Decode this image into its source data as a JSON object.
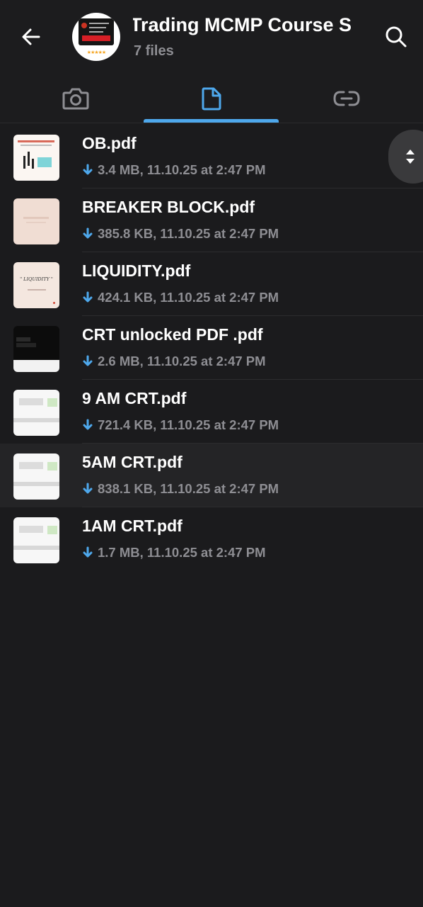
{
  "header": {
    "title": "Trading MCMP Course   S",
    "subtitle": "7 files",
    "avatar_stars": "★★★★★"
  },
  "tabs": [
    {
      "name": "media",
      "icon": "camera-icon",
      "active": false
    },
    {
      "name": "files",
      "icon": "file-icon",
      "active": true
    },
    {
      "name": "links",
      "icon": "link-icon",
      "active": false
    }
  ],
  "files": [
    {
      "name": "OB.pdf",
      "meta": "3.4 MB, 11.10.25 at 2:47 PM",
      "thumb": "ob"
    },
    {
      "name": "BREAKER BLOCK.pdf",
      "meta": "385.8 KB, 11.10.25 at 2:47 PM",
      "thumb": "breaker"
    },
    {
      "name": "LIQUIDITY.pdf",
      "meta": "424.1 KB, 11.10.25 at 2:47 PM",
      "thumb": "liquidity",
      "thumb_text": "\" LIQUIDITY \""
    },
    {
      "name": "CRT unlocked PDF .pdf",
      "meta": "2.6 MB, 11.10.25 at 2:47 PM",
      "thumb": "crt"
    },
    {
      "name": "9 AM CRT.pdf",
      "meta": "721.4 KB, 11.10.25 at 2:47 PM",
      "thumb": "doc"
    },
    {
      "name": "5AM CRT.pdf",
      "meta": "838.1 KB, 11.10.25 at 2:47 PM",
      "thumb": "doc",
      "highlighted": true
    },
    {
      "name": "1AM CRT.pdf",
      "meta": "1.7 MB, 11.10.25 at 2:47 PM",
      "thumb": "doc"
    }
  ],
  "colors": {
    "background": "#1b1b1d",
    "accent": "#4ea8ec",
    "secondary_text": "#8e8e93"
  }
}
